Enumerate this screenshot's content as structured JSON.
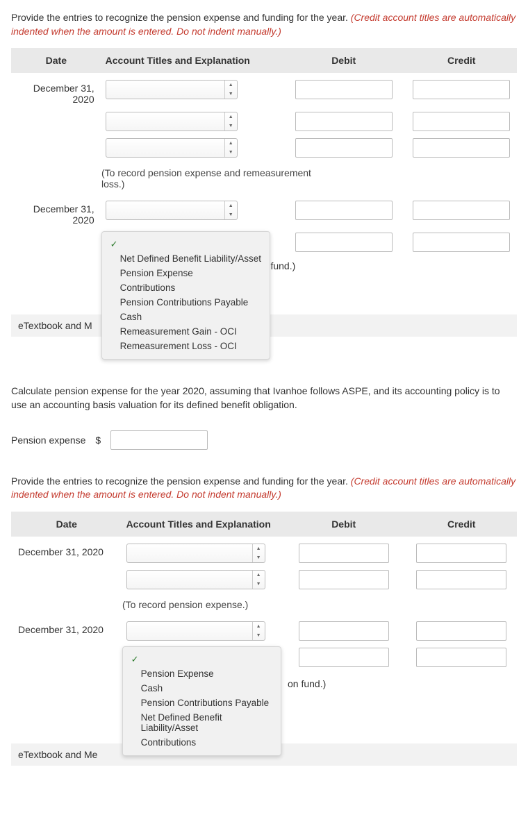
{
  "instruction1_a": "Provide the entries to recognize the pension expense and funding for the year. ",
  "instruction1_b": "(Credit account titles are automatically indented when the amount is entered. Do not indent manually.)",
  "headers": {
    "date": "Date",
    "account": "Account Titles and Explanation",
    "debit": "Debit",
    "credit": "Credit"
  },
  "table1": {
    "date1_line1": "December 31,",
    "date1_line2": "2020",
    "caption1": "(To record pension expense and remeasurement loss.)",
    "date2_line1": "December 31,",
    "date2_line2": "2020",
    "on_fund": "on fund.)",
    "dropdown_options": [
      "Net Defined Benefit Liability/Asset",
      "Pension Expense",
      "Contributions",
      "Pension Contributions Payable",
      "Cash",
      "Remeasurement Gain - OCI",
      "Remeasurement Loss - OCI"
    ]
  },
  "etextbook_label_1": "eTextbook and M",
  "calc_text": "Calculate pension expense for the year 2020, assuming that Ivanhoe follows ASPE, and its accounting policy is to use an accounting basis valuation for its defined benefit obligation.",
  "pension_expense_label": "Pension expense",
  "dollar": "$",
  "instruction2_a": "Provide the entries to recognize the pension expense and funding for the year. ",
  "instruction2_b": "(Credit account titles are automatically indented when the amount is entered. Do not indent manually.)",
  "table2": {
    "date1": "December 31, 2020",
    "caption1": "(To record pension expense.)",
    "date2": "December 31, 2020",
    "on_fund": "on fund.)",
    "dropdown_options": [
      "Pension Expense",
      "Cash",
      "Pension Contributions Payable",
      "Net Defined Benefit Liability/Asset",
      "Contributions"
    ]
  },
  "etextbook_label_2": "eTextbook and Me",
  "check_glyph": "✓"
}
